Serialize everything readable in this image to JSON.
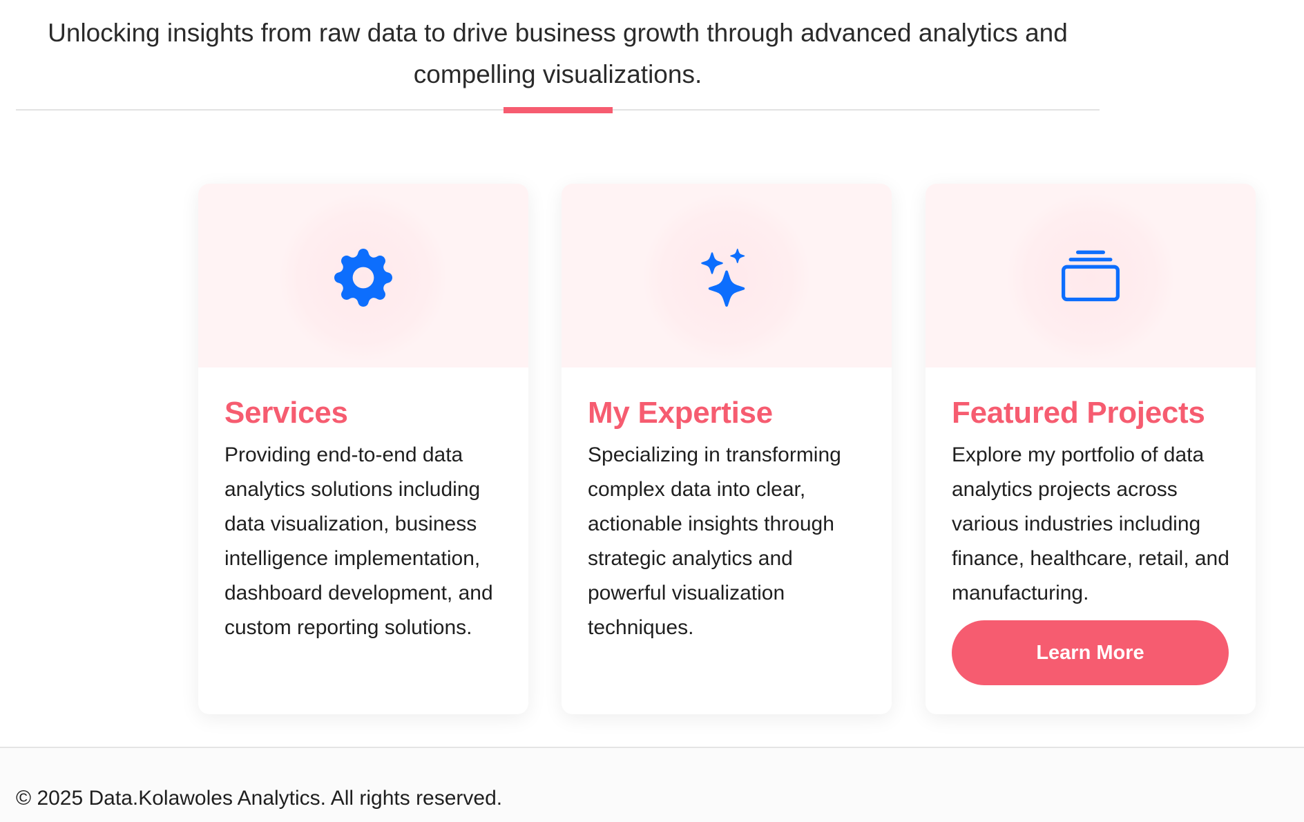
{
  "intro": {
    "text": "Unlocking insights from raw data to drive business growth through advanced analytics and compelling visualizations."
  },
  "cards": [
    {
      "icon": "gear-icon",
      "title": "Services",
      "text": "Providing end-to-end data analytics solutions including data visualization, business intelligence implementation, dashboard development, and custom reporting solutions."
    },
    {
      "icon": "sparkles-icon",
      "title": "My Expertise",
      "text": "Specializing in transforming complex data into clear, actionable insights through strategic analytics and powerful visualization techniques."
    },
    {
      "icon": "collection-icon",
      "title": "Featured Projects",
      "text": "Explore my portfolio of data analytics projects across various industries including finance, healthcare, retail, and manufacturing.",
      "button_label": "Learn More"
    }
  ],
  "footer": {
    "copyright": "© 2025 Data.Kolawoles Analytics. All rights reserved."
  },
  "colors": {
    "accent": "#f65c70",
    "icon": "#0d6efd",
    "card_top_bg": "#fff3f4"
  }
}
